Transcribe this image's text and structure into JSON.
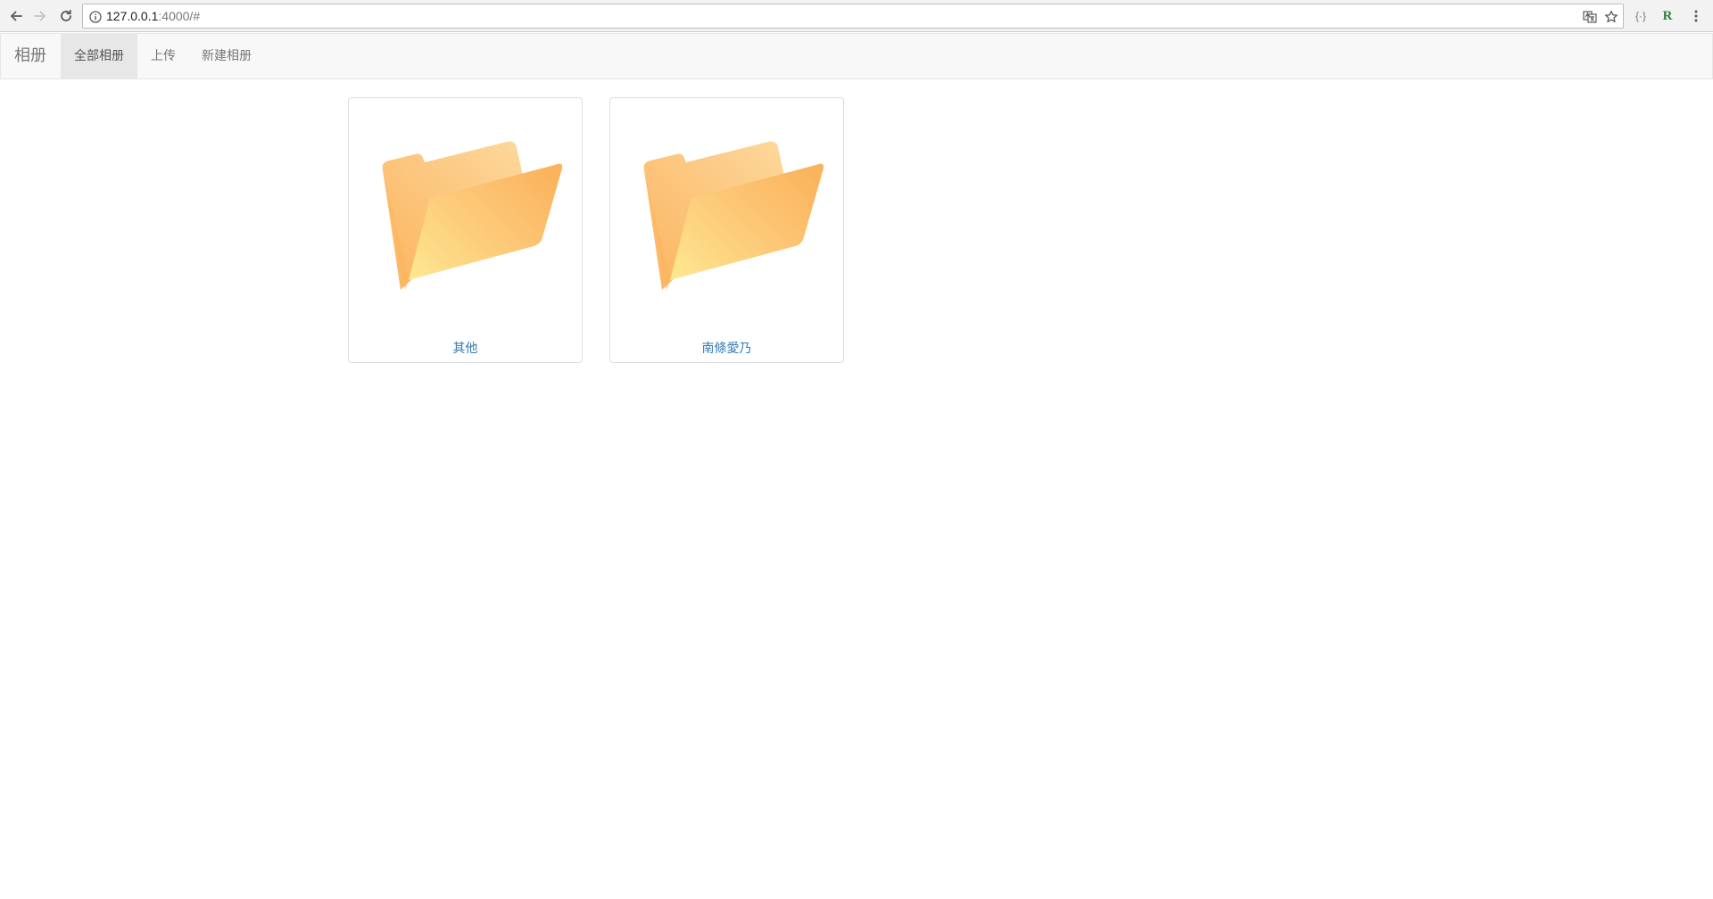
{
  "browser": {
    "url_host": "127.0.0.1",
    "url_rest": ":4000/#",
    "icons": {
      "back": "arrow-left-icon",
      "forward": "arrow-right-icon",
      "reload": "reload-icon",
      "info": "info-icon",
      "translate": "translate-icon",
      "bookmark": "star-icon",
      "ext_json": "json-braces-icon",
      "ext_r": "r-letter-icon",
      "menu": "kebab-menu-icon"
    },
    "ext_json_label": "{·}",
    "ext_r_label": "R"
  },
  "navbar": {
    "brand": "相册",
    "items": [
      {
        "label": "全部相册",
        "active": true
      },
      {
        "label": "上传",
        "active": false
      },
      {
        "label": "新建相册",
        "active": false
      }
    ]
  },
  "albums": [
    {
      "name": "其他",
      "icon": "folder-icon"
    },
    {
      "name": "南條愛乃",
      "icon": "folder-icon"
    }
  ],
  "colors": {
    "link": "#337ab7",
    "navbar_bg": "#f8f8f8",
    "nav_active_bg": "#e7e7e7",
    "folder_light": "#fde58e",
    "folder_dark": "#fbb45e",
    "ext_r_green": "#2e7d32"
  }
}
